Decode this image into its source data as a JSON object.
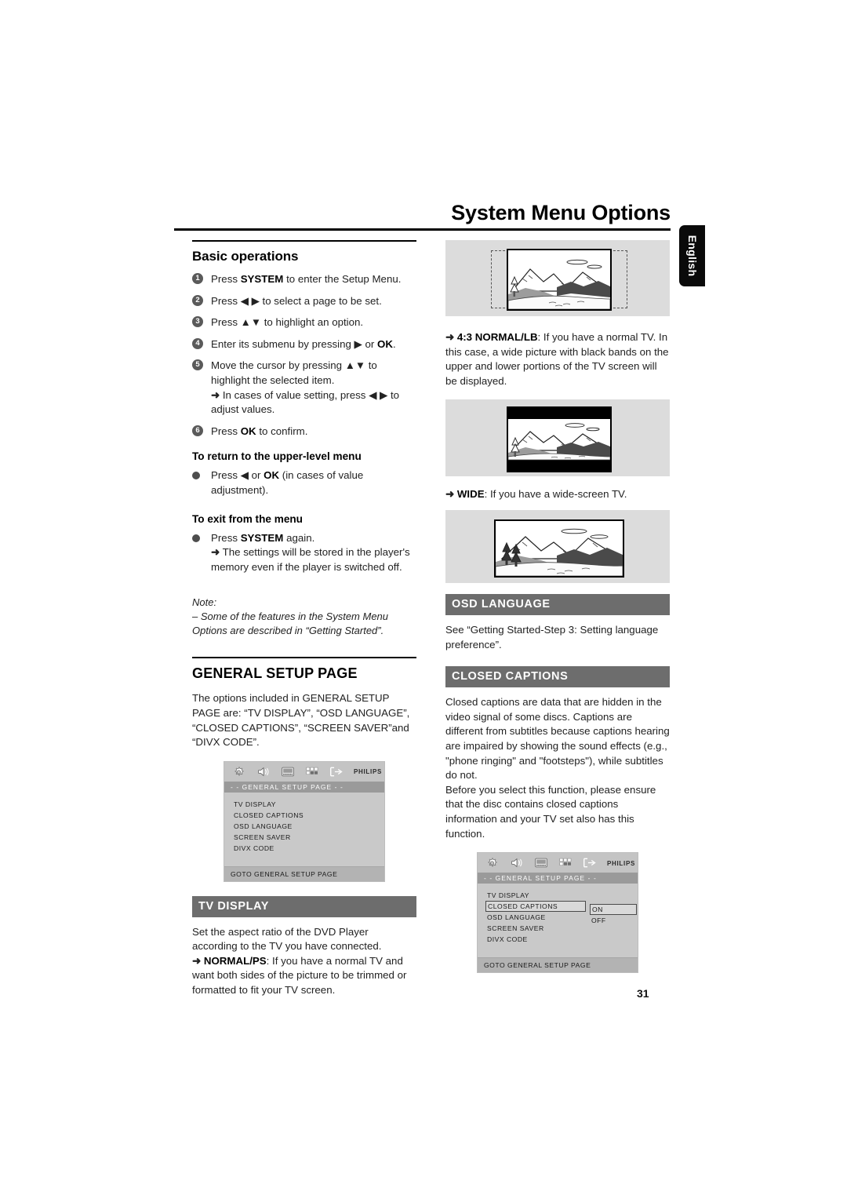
{
  "header": {
    "title": "System Menu Options",
    "language_tab": "English"
  },
  "page_number": "31",
  "left_column": {
    "basic_operations": {
      "heading": "Basic operations",
      "steps": [
        {
          "num": "1",
          "text_html": "Press <b class=\"kw\">SYSTEM</b> to enter the Setup Menu."
        },
        {
          "num": "2",
          "text_html": "Press ◀ ▶ to select a page to be set."
        },
        {
          "num": "3",
          "text_html": "Press ▲▼ to highlight an option."
        },
        {
          "num": "4",
          "text_html": "Enter its submenu by pressing ▶ or <b class=\"kw\">OK</b>."
        },
        {
          "num": "5",
          "text_html": "Move the cursor by pressing ▲▼ to highlight the selected item.<br><span class=\"arrow-g\">➜</span> In cases of value setting, press ◀ ▶ to adjust values."
        },
        {
          "num": "6",
          "text_html": "Press <b class=\"kw\">OK</b> to confirm."
        }
      ],
      "return_subhead": "To return to the upper-level menu",
      "return_bullet_html": "Press ◀ or <b class=\"kw\">OK</b> (in cases of value adjustment).",
      "exit_subhead": "To exit from the menu",
      "exit_bullet_html": "Press <b class=\"kw\">SYSTEM</b> again.<br><span class=\"arrow-g\">➜</span> The settings will be stored in the player's memory even if the player is switched off.",
      "note_label": "Note:",
      "note_text": "–  Some of the features in the System Menu Options are described in “Getting Started”."
    },
    "general_setup": {
      "heading": "GENERAL SETUP PAGE",
      "body": "The options included in GENERAL SETUP PAGE are: “TV DISPLAY”, “OSD LANGUAGE”, “CLOSED CAPTIONS”, “SCREEN SAVER”and “DIVX CODE”."
    },
    "osd_menu_1": {
      "icons": [
        "gear-icon",
        "speaker-icon",
        "video-screen-icon",
        "preference-grid-icon",
        "exit-arrow-icon"
      ],
      "brand": "PHILIPS",
      "page_bar": "- - GENERAL  SETUP  PAGE - -",
      "items": [
        "TV DISPLAY",
        "CLOSED CAPTIONS",
        "OSD LANGUAGE",
        "SCREEN SAVER",
        "DIVX CODE"
      ],
      "footer": "GOTO GENERAL SETUP PAGE"
    },
    "tv_display": {
      "banner": "TV DISPLAY",
      "body": "Set the aspect ratio of the DVD Player according to the TV you have connected.",
      "option_html": "<span class=\"arrow-g\">➜</span> <b class=\"kw\">NORMAL/PS</b>: If you have a normal TV and want both sides of the picture to be trimmed or formatted to fit your TV screen."
    }
  },
  "right_column": {
    "illustration_1": "pan-scan-4-3-trimmed-sides",
    "normal_lb_html": "<span class=\"arrow-g\">➜</span> <b class=\"kw\">4:3 NORMAL/LB</b>: If you have a normal TV. In this case, a wide picture with black bands on the upper and lower portions of the TV screen will be displayed.",
    "illustration_2": "letterbox-4-3-black-bands",
    "wide_html": "<span class=\"arrow-g\">➜</span> <b class=\"kw\">WIDE</b>: If you have a wide-screen TV.",
    "illustration_3": "widescreen-16-9",
    "osd_language": {
      "banner": "OSD LANGUAGE",
      "body": "See “Getting Started-Step 3: Setting language preference”."
    },
    "closed_captions": {
      "banner": "CLOSED CAPTIONS",
      "body_1": "Closed captions are data that are hidden in the video signal of some discs. Captions are different from subtitles because captions hearing are impaired by showing the sound effects (e.g., \"phone ringing\" and \"footsteps\"), while subtitles do not.",
      "body_2": "Before you select this function, please ensure that the disc contains closed captions information and your TV set also has this function."
    },
    "osd_menu_2": {
      "icons": [
        "gear-icon",
        "speaker-icon",
        "video-screen-icon",
        "preference-grid-icon",
        "exit-arrow-icon"
      ],
      "brand": "PHILIPS",
      "page_bar": "- - GENERAL  SETUP  PAGE - -",
      "items": [
        "TV DISPLAY",
        "CLOSED CAPTIONS",
        "OSD LANGUAGE",
        "SCREEN SAVER",
        "DIVX CODE"
      ],
      "selected_item": "CLOSED CAPTIONS",
      "submenu": [
        "ON",
        "OFF"
      ],
      "footer": "GOTO GENERAL SETUP PAGE"
    }
  }
}
